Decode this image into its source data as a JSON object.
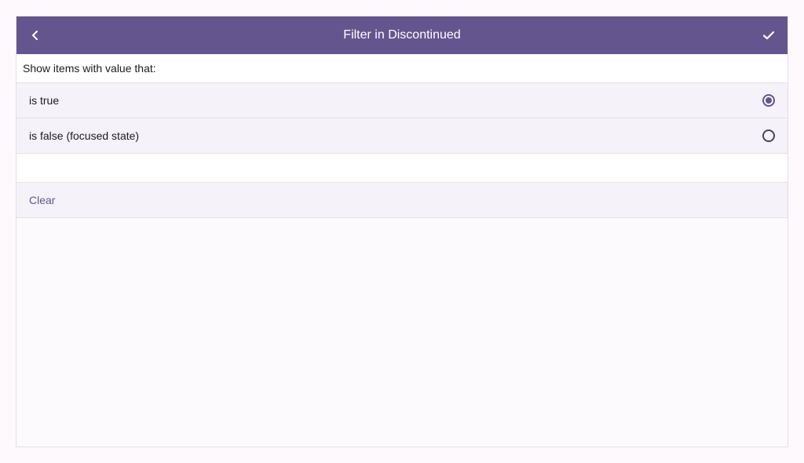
{
  "header": {
    "title": "Filter in Discontinued",
    "back_icon": "chevron-left-icon",
    "confirm_icon": "check-icon"
  },
  "prompt": "Show items with value that:",
  "options": [
    {
      "label": "is true",
      "selected": true
    },
    {
      "label": "is false (focused state)",
      "selected": false
    }
  ],
  "clear_label": "Clear",
  "colors": {
    "accent": "#65558f",
    "background": "#fdf9fd",
    "option_background": "#f5f2f9"
  }
}
